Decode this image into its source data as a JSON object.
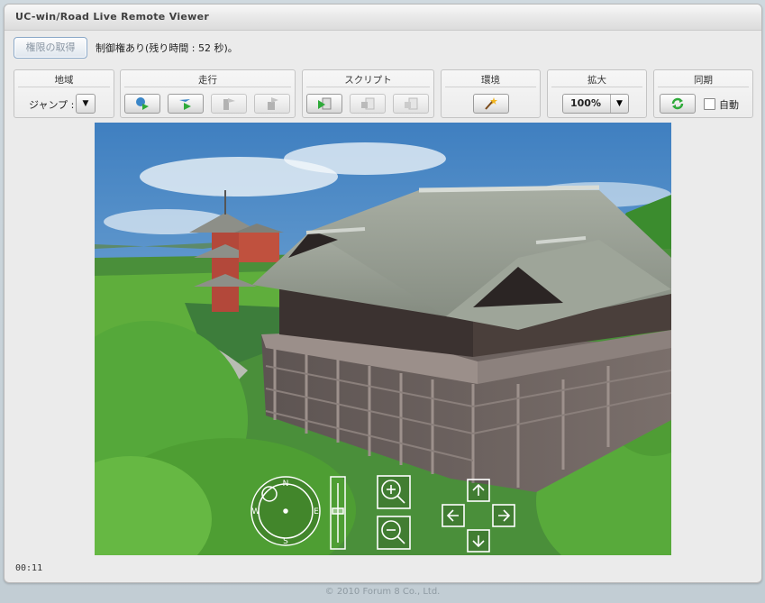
{
  "window": {
    "title": "UC-win/Road Live Remote Viewer"
  },
  "toolbar_top": {
    "acquire_button": "権限の取得",
    "control_status": "制御権あり(残り時間 : 52 秒)。"
  },
  "groups": {
    "region": {
      "label": "地域",
      "jump_label": "ジャンプ :",
      "dropdown_icon": "chevron-down-icon"
    },
    "drive": {
      "label": "走行",
      "buttons": [
        "drive-start-icon",
        "fly-mode-icon",
        "stop-drive-icon",
        "reset-drive-icon"
      ]
    },
    "script": {
      "label": "スクリプト",
      "buttons": [
        "script-play-icon",
        "script-stop-icon",
        "script-pause-icon"
      ]
    },
    "environment": {
      "label": "環境",
      "button_icon": "magic-wand-icon"
    },
    "zoom": {
      "label": "拡大",
      "value": "100%"
    },
    "sync": {
      "label": "同期",
      "button_icon": "refresh-icon",
      "auto_label": "自動",
      "auto_checked": false
    }
  },
  "viewer": {
    "compass_letters": [
      "N",
      "E",
      "S",
      "W"
    ],
    "controls": [
      "compass-dial",
      "altitude-slider",
      "zoom-in-icon",
      "zoom-out-icon",
      "arrow-up-icon",
      "arrow-down-icon",
      "arrow-left-icon",
      "arrow-right-icon"
    ]
  },
  "status": {
    "timer": "00:11"
  },
  "footer": {
    "copyright": "© 2010 Forum 8 Co., Ltd."
  },
  "colors": {
    "sky": "#6fa8d6",
    "grass": "#3f9e2e",
    "roof": "#9aa39a",
    "building": "#6c6260"
  }
}
